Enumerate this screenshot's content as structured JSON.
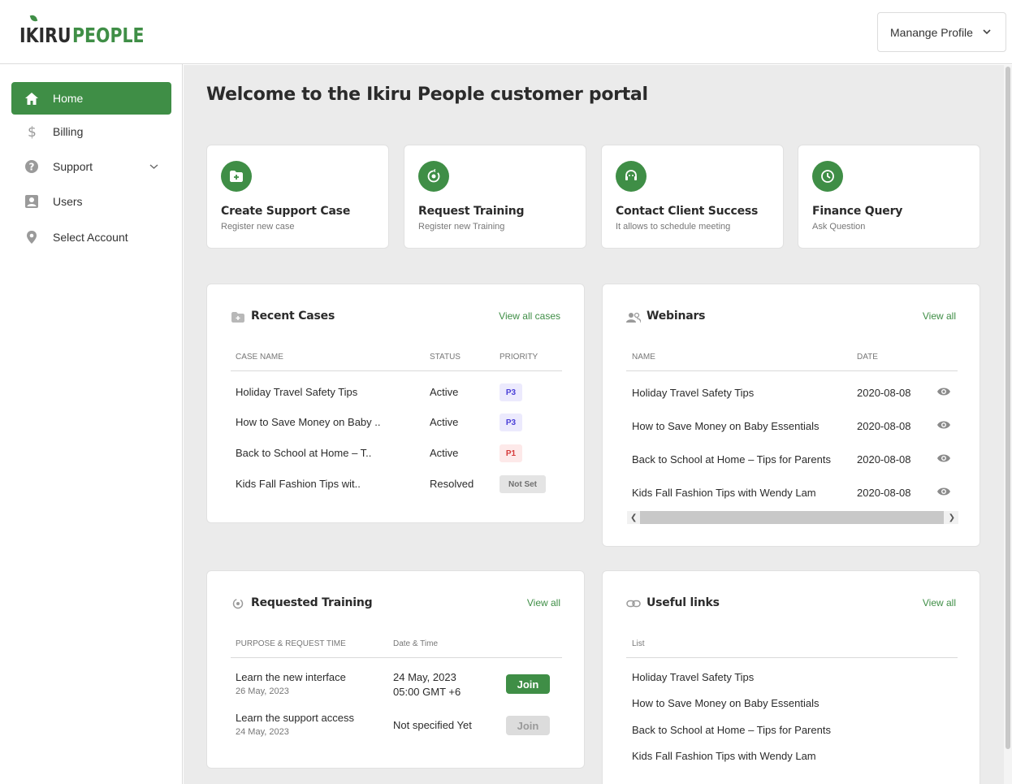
{
  "brand": {
    "part1": "IKIRU",
    "part2": "PEOPLE"
  },
  "header": {
    "profile_label": "Manange Profile"
  },
  "sidebar": {
    "items": [
      {
        "label": "Home",
        "icon": "home-icon",
        "active": true
      },
      {
        "label": "Billing",
        "icon": "dollar-icon"
      },
      {
        "label": "Support",
        "icon": "help-icon",
        "expandable": true
      },
      {
        "label": "Users",
        "icon": "user-icon"
      },
      {
        "label": "Select Account",
        "icon": "location-pin-icon"
      }
    ]
  },
  "main": {
    "title": "Welcome to the Ikiru People customer portal",
    "quick_actions": [
      {
        "title": "Create Support Case",
        "subtitle": "Register new case",
        "icon": "folder-plus-icon"
      },
      {
        "title": "Request Training",
        "subtitle": "Register new Training",
        "icon": "training-icon"
      },
      {
        "title": "Contact Client Success",
        "subtitle": "It allows to schedule meeting",
        "icon": "headset-icon"
      },
      {
        "title": "Finance Query",
        "subtitle": "Ask Question",
        "icon": "clock-icon"
      }
    ],
    "recent_cases": {
      "title": "Recent Cases",
      "link": "View all cases",
      "columns": [
        "CASE NAME",
        "STATUS",
        "PRIORITY"
      ],
      "rows": [
        {
          "name": "Holiday Travel Safety Tips",
          "status": "Active",
          "priority": "P3"
        },
        {
          "name": "How to Save Money on Baby ..",
          "status": "Active",
          "priority": "P3"
        },
        {
          "name": "Back to School at Home – T..",
          "status": "Active",
          "priority": "P1"
        },
        {
          "name": "Kids Fall Fashion Tips wit..",
          "status": "Resolved",
          "priority": "Not Set"
        }
      ]
    },
    "webinars": {
      "title": "Webinars",
      "link": "View all",
      "columns": [
        "NAME",
        "DATE"
      ],
      "rows": [
        {
          "name": "Holiday Travel Safety Tips",
          "date": "2020-08-08"
        },
        {
          "name": "How to Save Money on Baby Essentials",
          "date": "2020-08-08"
        },
        {
          "name": "Back to School at Home – Tips for Parents",
          "date": "2020-08-08"
        },
        {
          "name": "Kids Fall Fashion Tips with Wendy Lam",
          "date": "2020-08-08"
        }
      ]
    },
    "requested_training": {
      "title": "Requested Training",
      "link": "View all",
      "columns": [
        "PURPOSE & REQUEST TIME",
        "Date & Time"
      ],
      "rows": [
        {
          "purpose": "Learn the new interface",
          "requested": "26 May, 2023",
          "date_line1": "24 May, 2023",
          "date_line2": "05:00 GMT +6",
          "action": "Join",
          "enabled": true
        },
        {
          "purpose": "Learn the support access",
          "requested": "24 May, 2023",
          "date_line1": "Not specified Yet",
          "date_line2": "",
          "action": "Join",
          "enabled": false
        }
      ]
    },
    "useful_links": {
      "title": "Useful links",
      "link": "View all",
      "columns": [
        "List"
      ],
      "rows": [
        "Holiday Travel Safety Tips",
        "How to Save Money on Baby Essentials",
        "Back to School at Home – Tips for Parents",
        "Kids Fall Fashion Tips with Wendy Lam"
      ]
    }
  },
  "colors": {
    "accent": "#3f8e46",
    "p3_text": "#4a3fd8",
    "p1_text": "#d63a3a",
    "background": "#ebebeb"
  }
}
